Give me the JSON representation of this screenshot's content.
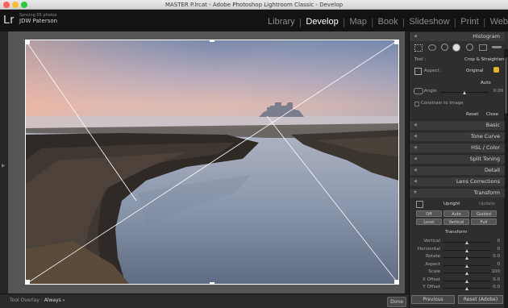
{
  "window": {
    "title": "MASTER P.lrcat - Adobe Photoshop Lightroom Classic - Develop"
  },
  "identity": {
    "logo": "Lr",
    "sync_status": "Syncing 55 photos",
    "name": "JDW Paterson"
  },
  "modules": [
    "Library",
    "Develop",
    "Map",
    "Book",
    "Slideshow",
    "Print",
    "Web"
  ],
  "active_module": "Develop",
  "toolbar": {
    "tool_overlay_label": "Tool Overlay :",
    "tool_overlay_value": "Always",
    "done_label": "Done"
  },
  "right_panel": {
    "histogram_label": "Histogram",
    "crop": {
      "tool_label": "Tool :",
      "tool_value": "Crop & Straighten",
      "aspect_label": "Aspect :",
      "aspect_value": "Original",
      "auto_label": "Auto",
      "angle_label": "Angle",
      "angle_value": "0.00",
      "constrain_label": "Constrain to Image",
      "reset_label": "Reset",
      "close_label": "Close"
    },
    "panels": [
      "Basic",
      "Tone Curve",
      "HSL / Color",
      "Split Toning",
      "Detail",
      "Lens Corrections",
      "Transform"
    ],
    "transform": {
      "upright_label": "Upright",
      "update_label": "Update",
      "buttons": [
        "Off",
        "Auto",
        "Guided",
        "Level",
        "Vertical",
        "Full"
      ],
      "section_label": "Transform",
      "sliders": [
        {
          "label": "Vertical",
          "value": "0",
          "pos": 0.5
        },
        {
          "label": "Horizontal",
          "value": "0",
          "pos": 0.5
        },
        {
          "label": "Rotate",
          "value": "0.0",
          "pos": 0.5
        },
        {
          "label": "Aspect",
          "value": "0",
          "pos": 0.5
        },
        {
          "label": "Scale",
          "value": "100",
          "pos": 0.5
        },
        {
          "label": "X Offset",
          "value": "0.0",
          "pos": 0.5
        },
        {
          "label": "Y Offset",
          "value": "0.0",
          "pos": 0.5
        }
      ]
    },
    "footer": {
      "previous_label": "Previous",
      "reset_label": "Reset (Adobe)"
    }
  },
  "colors": {
    "accent_lock": "#e7b324",
    "active_module": "#ffffff",
    "inactive_module": "#8d8d8d"
  }
}
